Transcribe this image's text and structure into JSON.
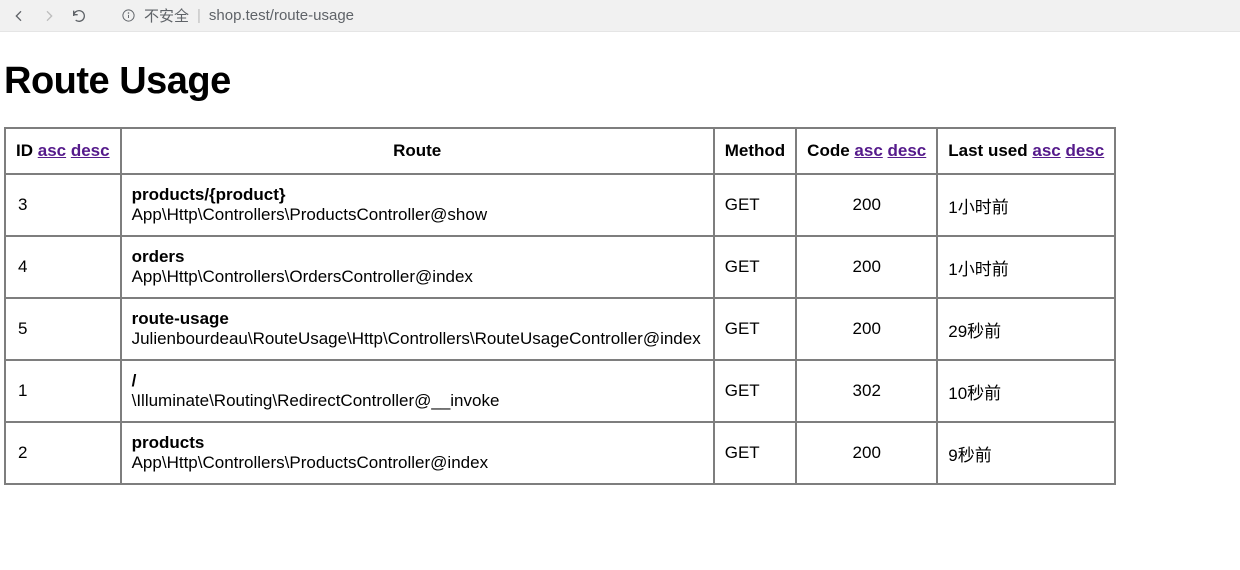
{
  "browser": {
    "security_label": "不安全",
    "url_divider": "|",
    "url": "shop.test/route-usage"
  },
  "page": {
    "title": "Route Usage"
  },
  "table": {
    "headers": {
      "id_label": "ID",
      "route_label": "Route",
      "method_label": "Method",
      "code_label": "Code",
      "lastused_label": "Last used",
      "sort_asc": "asc",
      "sort_desc": "desc"
    },
    "rows": [
      {
        "id": "3",
        "path": "products/{product}",
        "action": "App\\Http\\Controllers\\ProductsController@show",
        "method": "GET",
        "code": "200",
        "last_used": "1小时前"
      },
      {
        "id": "4",
        "path": "orders",
        "action": "App\\Http\\Controllers\\OrdersController@index",
        "method": "GET",
        "code": "200",
        "last_used": "1小时前"
      },
      {
        "id": "5",
        "path": "route-usage",
        "action": "Julienbourdeau\\RouteUsage\\Http\\Controllers\\RouteUsageController@index",
        "method": "GET",
        "code": "200",
        "last_used": "29秒前"
      },
      {
        "id": "1",
        "path": "/",
        "action": "\\Illuminate\\Routing\\RedirectController@__invoke",
        "method": "GET",
        "code": "302",
        "last_used": "10秒前"
      },
      {
        "id": "2",
        "path": "products",
        "action": "App\\Http\\Controllers\\ProductsController@index",
        "method": "GET",
        "code": "200",
        "last_used": "9秒前"
      }
    ]
  }
}
